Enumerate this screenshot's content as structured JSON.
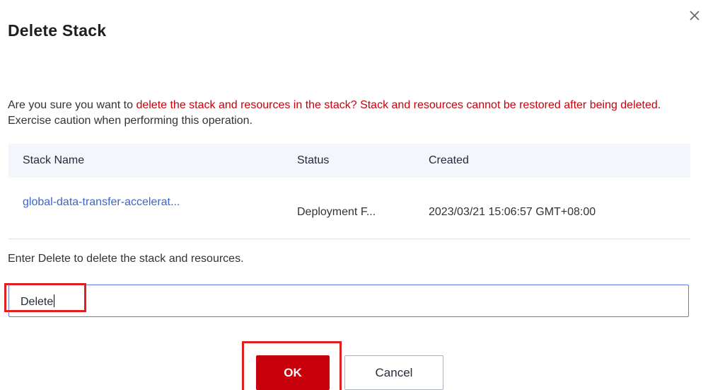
{
  "dialog": {
    "title": "Delete Stack",
    "warning": {
      "prefix": "Are you sure you want to ",
      "danger": "delete the stack and resources in the stack? Stack and resources cannot be restored after being deleted",
      "suffix": ". Exercise caution when performing this operation."
    },
    "table": {
      "headers": [
        "Stack Name",
        "Status",
        "Created"
      ],
      "rows": [
        {
          "name": "global-data-transfer-accelerat...",
          "status": "Deployment F...",
          "created": "2023/03/21 15:06:57 GMT+08:00"
        }
      ]
    },
    "hint": "Enter Delete to delete the stack and resources.",
    "input_value": "Delete",
    "ok_label": "OK",
    "cancel_label": "Cancel"
  },
  "colors": {
    "danger": "#c7000b",
    "link": "#3a66c9",
    "input_border": "#5e7ce0",
    "annotation": "#e02020"
  },
  "icons": {
    "close": "close-icon"
  }
}
